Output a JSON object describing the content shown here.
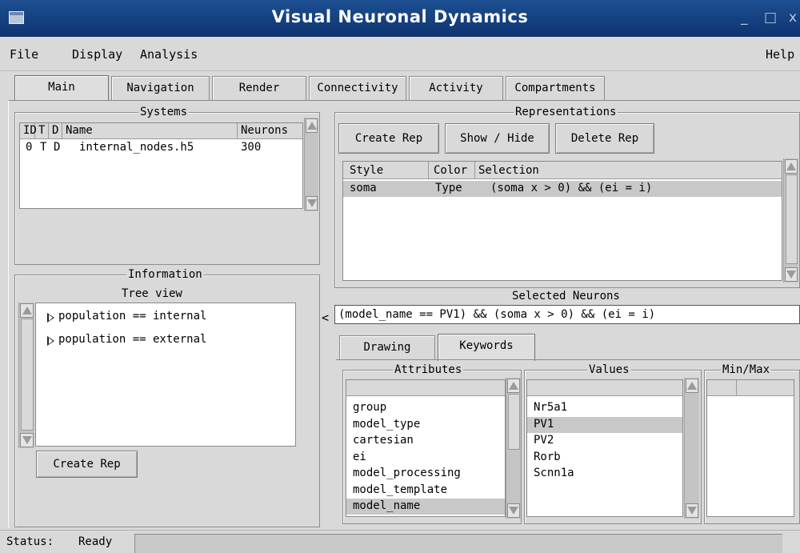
{
  "app": {
    "title": "Visual Neuronal Dynamics",
    "window_minimize": "_",
    "window_maximize": "□",
    "window_close": "x"
  },
  "menu": {
    "file": "File",
    "display": "Display",
    "analysis": "Analysis",
    "help": "Help"
  },
  "tabs": [
    "Main",
    "Navigation",
    "Render",
    "Connectivity",
    "Activity",
    "Compartments"
  ],
  "systems": {
    "legend": "Systems",
    "headers": [
      "ID",
      "T",
      "D",
      "Name",
      "Neurons"
    ],
    "rows": [
      {
        "id": "0",
        "t": "T",
        "d": "D",
        "name": "internal_nodes.h5",
        "neurons": "300"
      }
    ]
  },
  "information": {
    "legend": "Information",
    "tree_label": "Tree view",
    "tree_items": [
      "population == internal",
      "population == external"
    ],
    "create_rep": "Create Rep"
  },
  "representations": {
    "legend": "Representations",
    "create_rep": "Create Rep",
    "show_hide": "Show / Hide",
    "delete_rep": "Delete Rep",
    "headers": [
      "Style",
      "Color",
      "Selection"
    ],
    "rows": [
      {
        "style": "soma",
        "color": "Type",
        "selection": "(soma x > 0) && (ei = i)"
      }
    ]
  },
  "selected_neurons": {
    "label": "Selected Neurons",
    "collapse": "<",
    "value": "(model_name == PV1) && (soma x > 0) && (ei = i)"
  },
  "subtabs": [
    "Drawing",
    "Keywords"
  ],
  "attributes": {
    "legend": "Attributes",
    "items": [
      "group",
      "model_type",
      "cartesian",
      "ei",
      "model_processing",
      "model_template",
      "model_name"
    ],
    "selected": "model_name"
  },
  "values": {
    "legend": "Values",
    "items": [
      "Nr5a1",
      "PV1",
      "PV2",
      "Rorb",
      "Scnn1a"
    ],
    "selected": "PV1"
  },
  "minmax": {
    "legend": "Min/Max"
  },
  "status": {
    "label": "Status:",
    "value": "Ready"
  }
}
